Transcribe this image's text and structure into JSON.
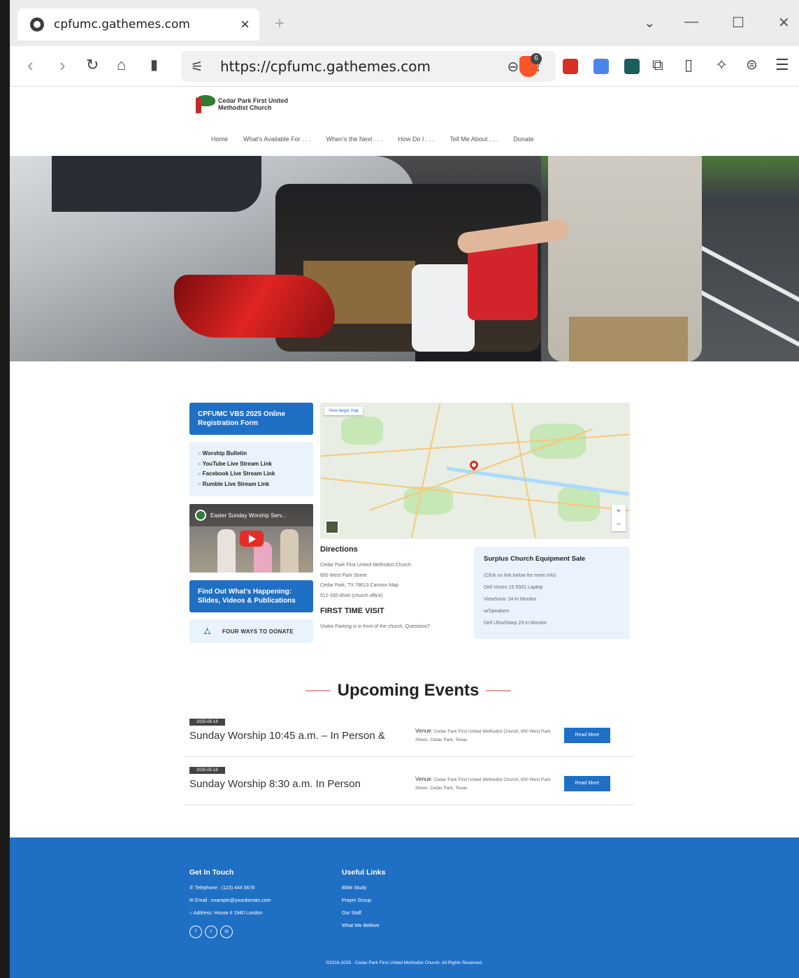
{
  "browser": {
    "tab_title": "cpfumc.gathemes.com",
    "url": "https://cpfumc.gathemes.com",
    "brave_badge": "6"
  },
  "site": {
    "logo_text": "Cedar Park First United Methodist Church",
    "nav": [
      "Home",
      "What's Available For . . .",
      "When's the Next . . .",
      "How Do I . . .",
      "Tell Me About . . .",
      "Donate"
    ]
  },
  "sidebar": {
    "vbs_button": "CPFUMC VBS 2025 Online Registration Form",
    "links": [
      "Worship Bulletin",
      "YouTube Live Stream Link",
      "Facebook Live Stream Link",
      "Rumble Live Stream Link"
    ],
    "video_title": "Easter Sunday Worship Serv...",
    "happening_button": "Find Out What's Happening: Slides, Videos & Publications",
    "donate_label": "FOUR WAYS TO DONATE"
  },
  "map": {
    "larger_map": "View larger map"
  },
  "directions": {
    "heading": "Directions",
    "lines": [
      "Cedar Park First United Methodist Church",
      "600 West Park Street",
      "Cedar Park, TX 78613 Cartoon Map",
      "512-335-8540 (church office)"
    ],
    "first_visit_heading": "FIRST TIME VISIT",
    "first_visit_text": "Visitor Parking is in front of the church. Questions?"
  },
  "surplus": {
    "heading": "Surplus Church Equipment Sale",
    "lines": [
      "(Click on link below for more info)",
      "Dell Vostro 15 5501 Laptop",
      "ViewSonic 24-in Monitor",
      "w/Speakers",
      "Dell UltraSharp 23-in Monitor"
    ]
  },
  "events": {
    "heading": "Upcoming Events",
    "items": [
      {
        "date": "2025-05-18",
        "name": "Sunday Worship 10:45 a.m. – In Person &",
        "venue_label": "Venue:",
        "venue": "Cedar Park First United Methodist Church, 600 West Park Street, Cedar Park, Texas",
        "button": "Read More"
      },
      {
        "date": "2025-05-18",
        "name": "Sunday Worship 8:30 a.m. In Person",
        "venue_label": "Venue:",
        "venue": "Cedar Park First United Methodist Church, 600 West Park Street, Cedar Park, Texas",
        "button": "Read More"
      }
    ]
  },
  "footer": {
    "contact_heading": "Get In Touch",
    "telephone": "Telephone : (123) 444 5678",
    "email": "Email : example@yourdomain.com",
    "address": "Address: House # 1940 London",
    "links_heading": "Useful Links",
    "links": [
      "Bible Study",
      "Prayer Group",
      "Our Staff",
      "What We Believe"
    ],
    "copyright": "©2016-2025 · Cedar Park First United Methodist Church. All Rights Reserved."
  }
}
